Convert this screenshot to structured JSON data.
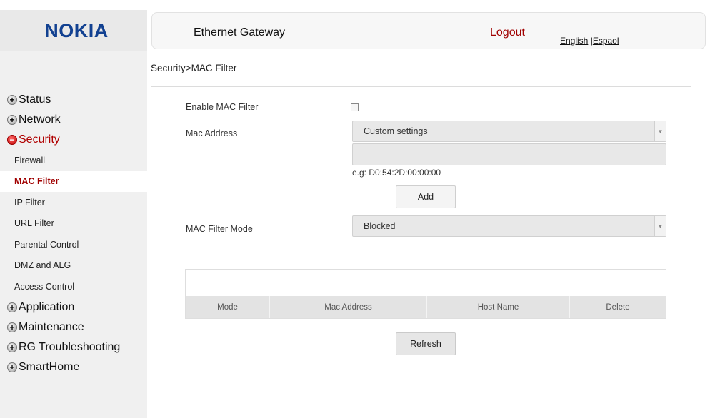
{
  "brand": {
    "logo": "NOKIA"
  },
  "header": {
    "title": "Ethernet Gateway",
    "logout": "Logout",
    "lang_english": "English",
    "lang_separator": "|",
    "lang_spanish": "Espaol"
  },
  "breadcrumb": "Security>MAC Filter",
  "sidebar": {
    "status": "Status",
    "network": "Network",
    "security": "Security",
    "security_items": {
      "firewall": "Firewall",
      "mac_filter": "MAC Filter",
      "ip_filter": "IP Filter",
      "url_filter": "URL Filter",
      "parental_control": "Parental Control",
      "dmz_alg": "DMZ and ALG",
      "access_control": "Access Control"
    },
    "application": "Application",
    "maintenance": "Maintenance",
    "rg_troubleshooting": "RG Troubleshooting",
    "smarthome": "SmartHome"
  },
  "form": {
    "enable_label": "Enable MAC Filter",
    "enable_checked": false,
    "mac_address_label": "Mac Address",
    "mac_address_select": "Custom settings",
    "mac_input_value": "",
    "example": "e.g: D0:54:2D:00:00:00",
    "add_button": "Add",
    "mode_label": "MAC Filter Mode",
    "mode_select": "Blocked"
  },
  "table": {
    "columns": [
      "Mode",
      "Mac Address",
      "Host Name",
      "Delete"
    ],
    "rows": []
  },
  "refresh_button": "Refresh",
  "colors": {
    "brand_blue": "#124191",
    "accent_red": "#a00000",
    "sidebar_bg": "#f0f0f0"
  },
  "icons": {
    "expand": "plus-circle-icon",
    "collapse": "minus-circle-icon",
    "dropdown": "chevron-down-icon"
  }
}
